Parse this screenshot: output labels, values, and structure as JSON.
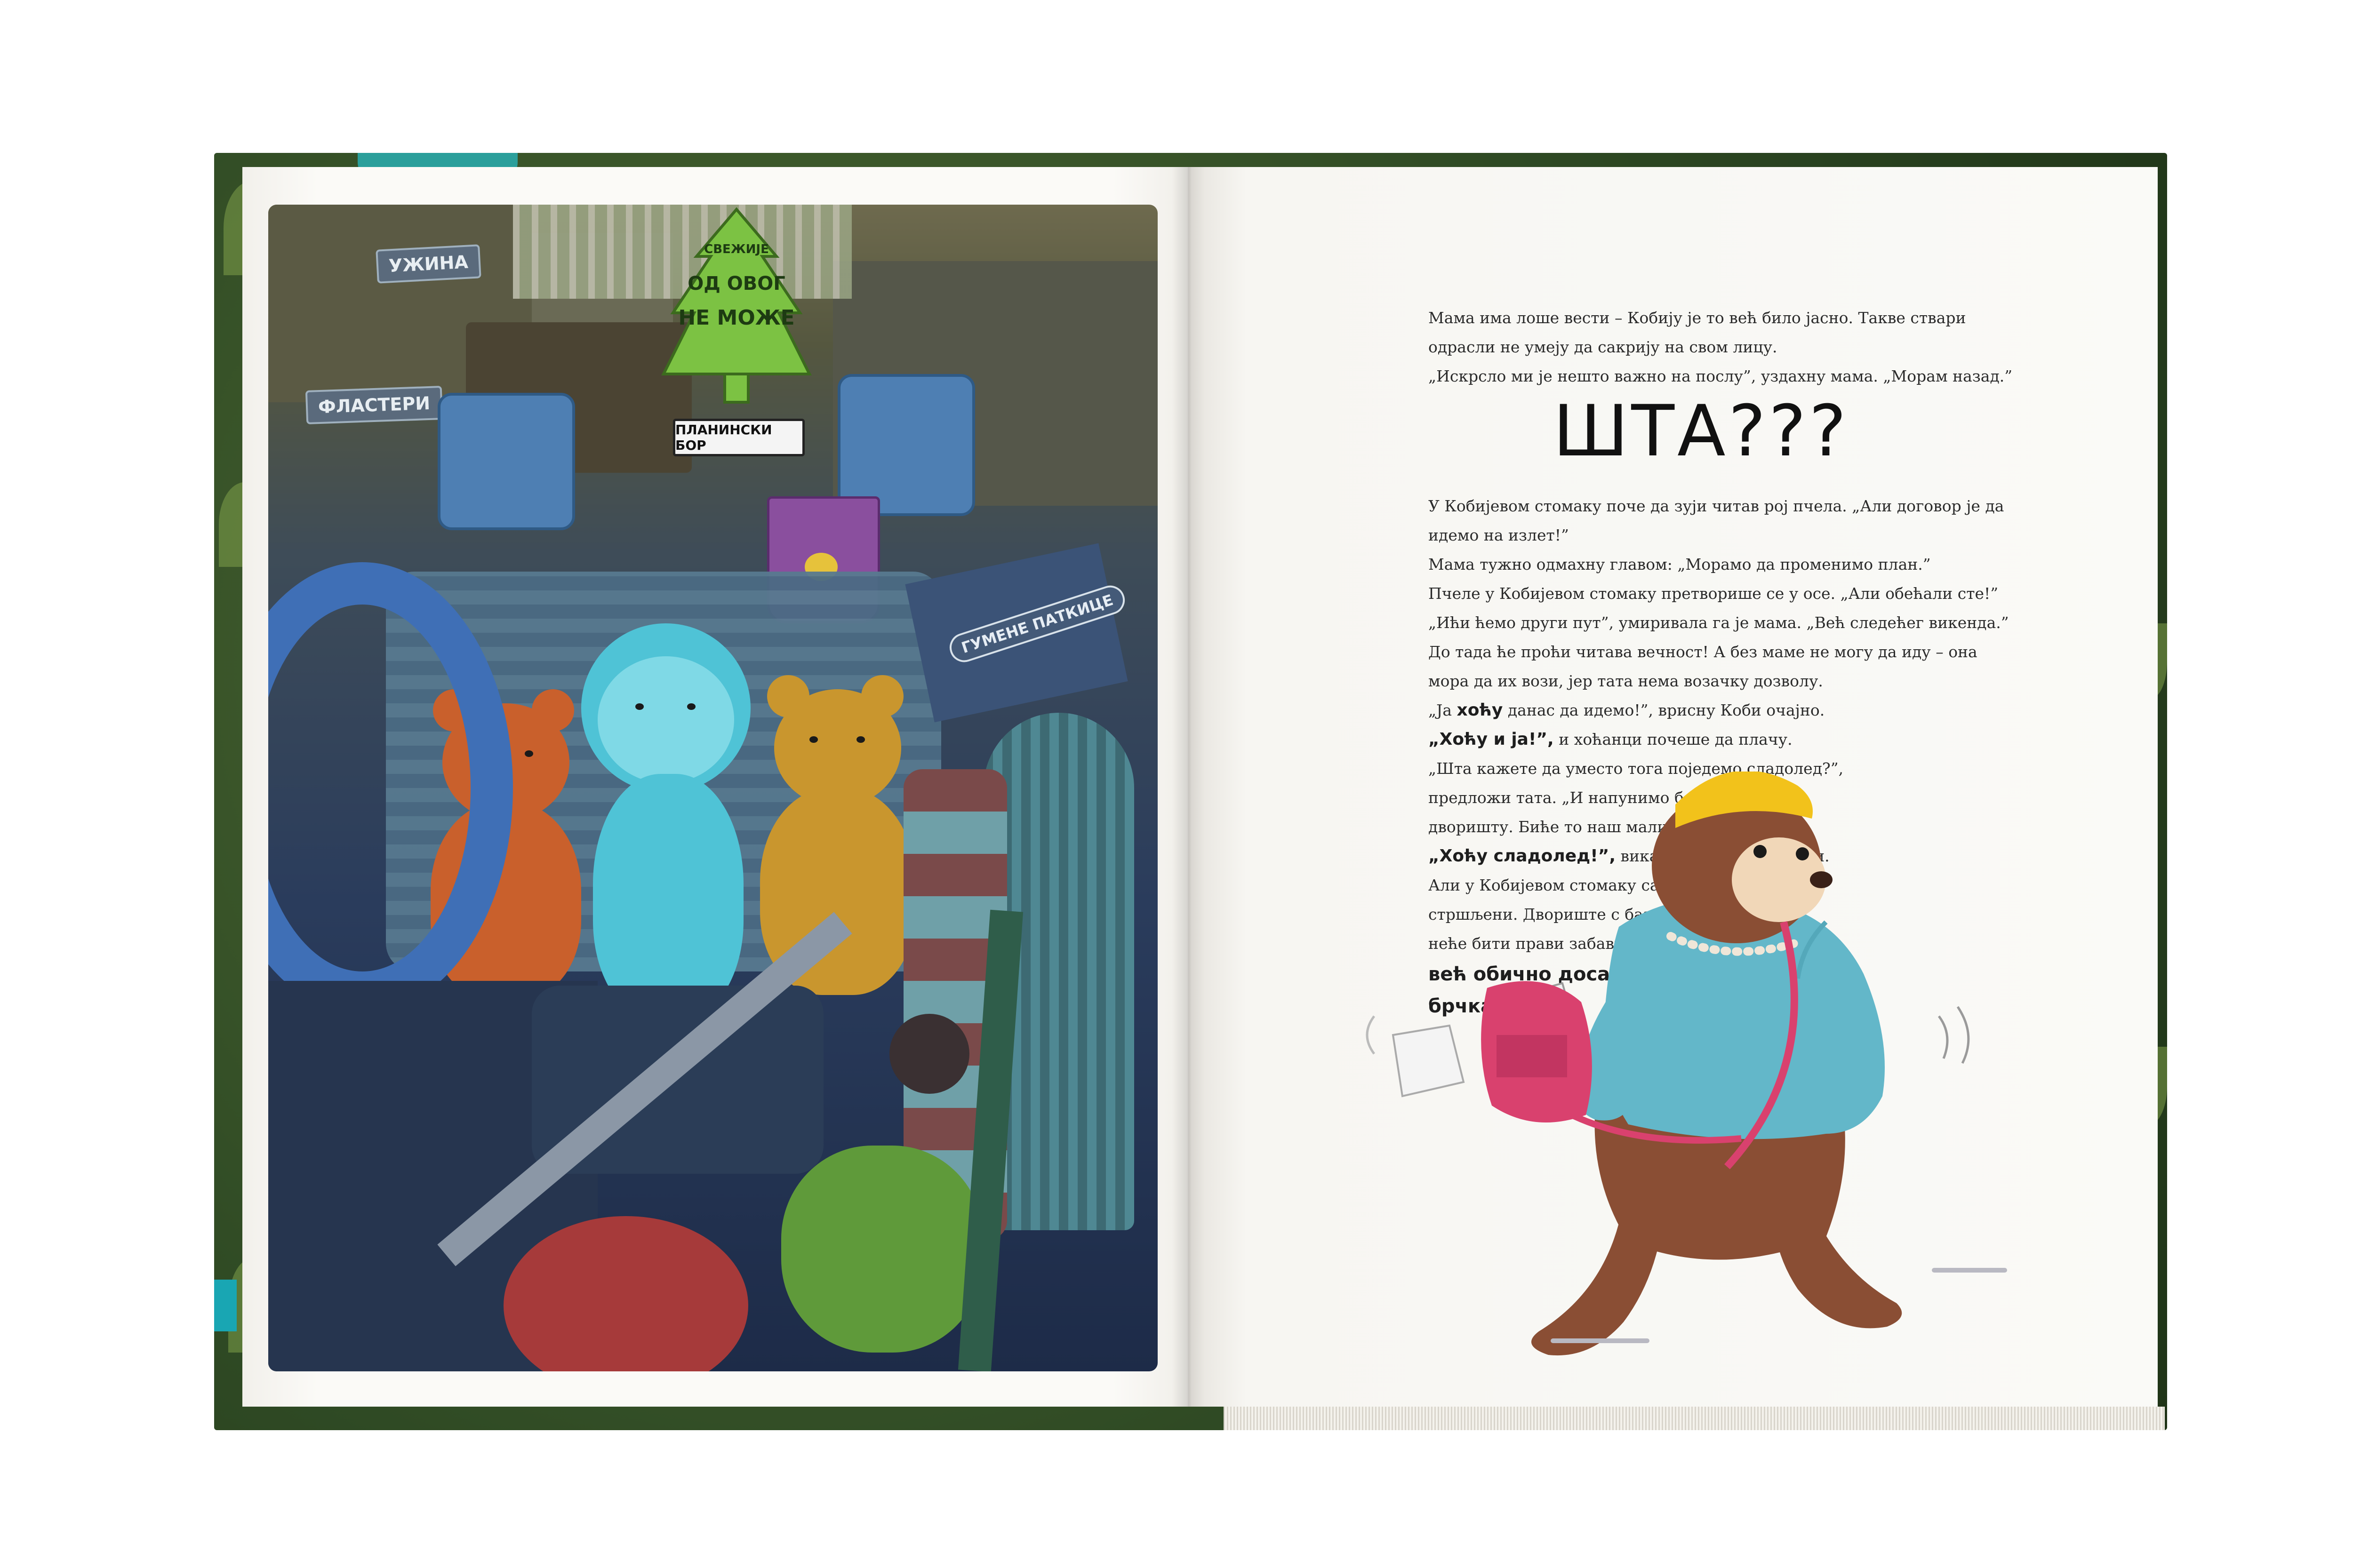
{
  "left_page": {
    "illustration": {
      "labels": {
        "snack_box": "УЖИНА",
        "bandages_box": "ФЛАСТЕРИ",
        "tree_line1": "СВЕЖИЈЕ",
        "tree_line2": "ОД ОВОГ",
        "tree_line3": "НЕ МОЖЕ",
        "tree_brand": "ПЛАНИНСКИ БОР",
        "ducks_box": "ГУМЕНЕ ПАТКИЦЕ"
      },
      "colors": {
        "orange_bear": "#c9602c",
        "blue_bear": "#4fc3d6",
        "yellow_bear": "#c9962e",
        "seat": "#5c7a8f",
        "air_freshener": "#7cc243",
        "bucket": "#8a4f9e"
      }
    }
  },
  "right_page": {
    "intro_lines": [
      "Мама има лоше вести – Кобију је то већ било јасно. Такве ствари",
      "одрасли не умеју да сакрију на свом лицу.",
      "„Искрсло ми је нешто важно на послу”, уздахну мама. „Морам назад.”"
    ],
    "shout": "ШТА???",
    "story": {
      "l1": "У Кобијевом стомаку поче да зуји читав рој пчела. „Али договор је да",
      "l2": "идемо на излет!”",
      "l3": "Мама тужно одмахну главом: „Морамо да променимо план.”",
      "l4": "Пчеле у Кобијевом стомаку претворише се у осе. „Али обећали сте!”",
      "l5": "„Ићи ћемо други пут”, умиривала га је мама. „Већ следећег викенда.”",
      "l6": "До тада ће проћи читава вечност! А без маме не могу да иду – она",
      "l7": "мора да их вози, јер тата нема возачку дозволу.",
      "l8_a": "„Ја ",
      "l8_b": "хоћу",
      "l8_c": " данас да идемо!”, врисну Коби очајно.",
      "l9_a": "„Хоћу и ја!”,",
      "l9_b": " и хоћанци почеше да плачу.",
      "l10": "„Шта кажете да уместо тога поједемо сладолед?”,",
      "l11": "предложи тата. „И напунимо базенчић у",
      "l12": "дворишту. Биће то наш мали забавни парк.”",
      "l13_a": "„Хоћу сладолед!”,",
      "l13_b": " викали су углас хоћанци.",
      "l14": "Али у Кобијевом стомаку сада су већ брујали",
      "l15": "стршљени. Двориште с базенчићем никада",
      "l16": "неће бити прави забавни парк,",
      "l17": "већ обично досадно",
      "l18": "брчкалиште!"
    },
    "illustration_colors": {
      "fur": "#8a4e34",
      "shirt": "#63b7c9",
      "bag": "#d9416e",
      "hat": "#f2c21b"
    }
  }
}
